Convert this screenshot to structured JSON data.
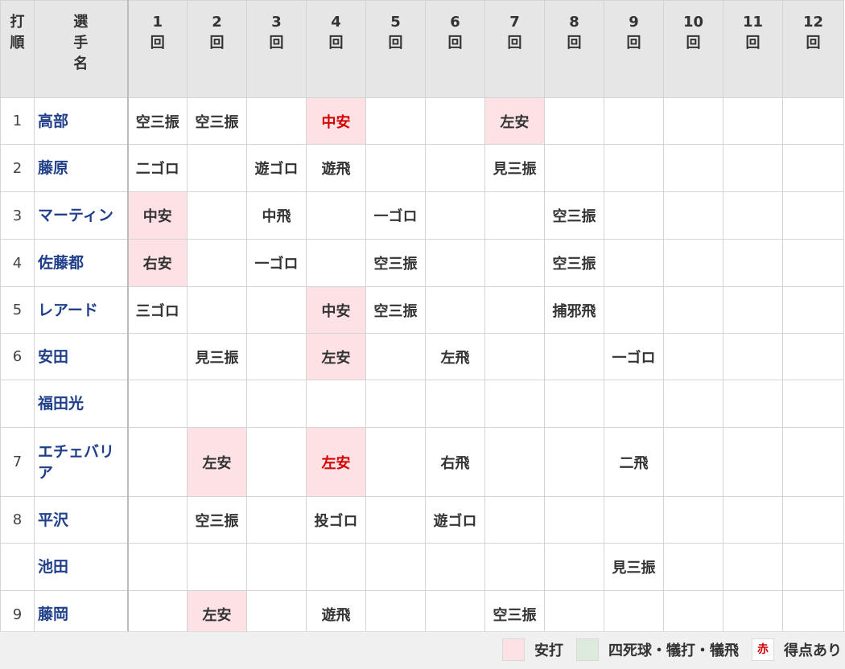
{
  "header": {
    "order_label": [
      "打",
      "順"
    ],
    "name_label": [
      "選",
      "手",
      "名"
    ],
    "innings": [
      [
        "1",
        "回"
      ],
      [
        "2",
        "回"
      ],
      [
        "3",
        "回"
      ],
      [
        "4",
        "回"
      ],
      [
        "5",
        "回"
      ],
      [
        "6",
        "回"
      ],
      [
        "7",
        "回"
      ],
      [
        "8",
        "回"
      ],
      [
        "9",
        "回"
      ],
      [
        "10",
        "回"
      ],
      [
        "11",
        "回"
      ],
      [
        "12",
        "回"
      ]
    ]
  },
  "rows": [
    {
      "order": "1",
      "name": "高部",
      "results": [
        {
          "text": "空三振",
          "type": ""
        },
        {
          "text": "空三振",
          "type": ""
        },
        {
          "text": "",
          "type": ""
        },
        {
          "text": "中安",
          "type": "hit",
          "scored": true
        },
        {
          "text": "",
          "type": ""
        },
        {
          "text": "",
          "type": ""
        },
        {
          "text": "左安",
          "type": "hit"
        },
        {
          "text": "",
          "type": ""
        },
        {
          "text": "",
          "type": ""
        },
        {
          "text": "",
          "type": ""
        },
        {
          "text": "",
          "type": ""
        },
        {
          "text": "",
          "type": ""
        }
      ]
    },
    {
      "order": "2",
      "name": "藤原",
      "results": [
        {
          "text": "二ゴロ",
          "type": ""
        },
        {
          "text": "",
          "type": ""
        },
        {
          "text": "遊ゴロ",
          "type": ""
        },
        {
          "text": "遊飛",
          "type": ""
        },
        {
          "text": "",
          "type": ""
        },
        {
          "text": "",
          "type": ""
        },
        {
          "text": "見三振",
          "type": ""
        },
        {
          "text": "",
          "type": ""
        },
        {
          "text": "",
          "type": ""
        },
        {
          "text": "",
          "type": ""
        },
        {
          "text": "",
          "type": ""
        },
        {
          "text": "",
          "type": ""
        }
      ]
    },
    {
      "order": "3",
      "name": "マーティン",
      "results": [
        {
          "text": "中安",
          "type": "hit"
        },
        {
          "text": "",
          "type": ""
        },
        {
          "text": "中飛",
          "type": ""
        },
        {
          "text": "",
          "type": ""
        },
        {
          "text": "一ゴロ",
          "type": ""
        },
        {
          "text": "",
          "type": ""
        },
        {
          "text": "",
          "type": ""
        },
        {
          "text": "空三振",
          "type": ""
        },
        {
          "text": "",
          "type": ""
        },
        {
          "text": "",
          "type": ""
        },
        {
          "text": "",
          "type": ""
        },
        {
          "text": "",
          "type": ""
        }
      ]
    },
    {
      "order": "4",
      "name": "佐藤都",
      "results": [
        {
          "text": "右安",
          "type": "hit"
        },
        {
          "text": "",
          "type": ""
        },
        {
          "text": "一ゴロ",
          "type": ""
        },
        {
          "text": "",
          "type": ""
        },
        {
          "text": "空三振",
          "type": ""
        },
        {
          "text": "",
          "type": ""
        },
        {
          "text": "",
          "type": ""
        },
        {
          "text": "空三振",
          "type": ""
        },
        {
          "text": "",
          "type": ""
        },
        {
          "text": "",
          "type": ""
        },
        {
          "text": "",
          "type": ""
        },
        {
          "text": "",
          "type": ""
        }
      ]
    },
    {
      "order": "5",
      "name": "レアード",
      "results": [
        {
          "text": "三ゴロ",
          "type": ""
        },
        {
          "text": "",
          "type": ""
        },
        {
          "text": "",
          "type": ""
        },
        {
          "text": "中安",
          "type": "hit"
        },
        {
          "text": "空三振",
          "type": ""
        },
        {
          "text": "",
          "type": ""
        },
        {
          "text": "",
          "type": ""
        },
        {
          "text": "捕邪飛",
          "type": ""
        },
        {
          "text": "",
          "type": ""
        },
        {
          "text": "",
          "type": ""
        },
        {
          "text": "",
          "type": ""
        },
        {
          "text": "",
          "type": ""
        }
      ]
    },
    {
      "order": "6",
      "name": "安田",
      "results": [
        {
          "text": "",
          "type": ""
        },
        {
          "text": "見三振",
          "type": ""
        },
        {
          "text": "",
          "type": ""
        },
        {
          "text": "左安",
          "type": "hit"
        },
        {
          "text": "",
          "type": ""
        },
        {
          "text": "左飛",
          "type": ""
        },
        {
          "text": "",
          "type": ""
        },
        {
          "text": "",
          "type": ""
        },
        {
          "text": "一ゴロ",
          "type": ""
        },
        {
          "text": "",
          "type": ""
        },
        {
          "text": "",
          "type": ""
        },
        {
          "text": "",
          "type": ""
        }
      ]
    },
    {
      "order": "",
      "name": "福田光",
      "results": [
        {
          "text": "",
          "type": ""
        },
        {
          "text": "",
          "type": ""
        },
        {
          "text": "",
          "type": ""
        },
        {
          "text": "",
          "type": ""
        },
        {
          "text": "",
          "type": ""
        },
        {
          "text": "",
          "type": ""
        },
        {
          "text": "",
          "type": ""
        },
        {
          "text": "",
          "type": ""
        },
        {
          "text": "",
          "type": ""
        },
        {
          "text": "",
          "type": ""
        },
        {
          "text": "",
          "type": ""
        },
        {
          "text": "",
          "type": ""
        }
      ]
    },
    {
      "order": "7",
      "name": "エチェバリア",
      "results": [
        {
          "text": "",
          "type": ""
        },
        {
          "text": "左安",
          "type": "hit"
        },
        {
          "text": "",
          "type": ""
        },
        {
          "text": "左安",
          "type": "hit",
          "scored": true
        },
        {
          "text": "",
          "type": ""
        },
        {
          "text": "右飛",
          "type": ""
        },
        {
          "text": "",
          "type": ""
        },
        {
          "text": "",
          "type": ""
        },
        {
          "text": "二飛",
          "type": ""
        },
        {
          "text": "",
          "type": ""
        },
        {
          "text": "",
          "type": ""
        },
        {
          "text": "",
          "type": ""
        }
      ]
    },
    {
      "order": "8",
      "name": "平沢",
      "results": [
        {
          "text": "",
          "type": ""
        },
        {
          "text": "空三振",
          "type": ""
        },
        {
          "text": "",
          "type": ""
        },
        {
          "text": "投ゴロ",
          "type": ""
        },
        {
          "text": "",
          "type": ""
        },
        {
          "text": "遊ゴロ",
          "type": ""
        },
        {
          "text": "",
          "type": ""
        },
        {
          "text": "",
          "type": ""
        },
        {
          "text": "",
          "type": ""
        },
        {
          "text": "",
          "type": ""
        },
        {
          "text": "",
          "type": ""
        },
        {
          "text": "",
          "type": ""
        }
      ]
    },
    {
      "order": "",
      "name": "池田",
      "results": [
        {
          "text": "",
          "type": ""
        },
        {
          "text": "",
          "type": ""
        },
        {
          "text": "",
          "type": ""
        },
        {
          "text": "",
          "type": ""
        },
        {
          "text": "",
          "type": ""
        },
        {
          "text": "",
          "type": ""
        },
        {
          "text": "",
          "type": ""
        },
        {
          "text": "",
          "type": ""
        },
        {
          "text": "見三振",
          "type": ""
        },
        {
          "text": "",
          "type": ""
        },
        {
          "text": "",
          "type": ""
        },
        {
          "text": "",
          "type": ""
        }
      ]
    },
    {
      "order": "9",
      "name": "藤岡",
      "results": [
        {
          "text": "",
          "type": ""
        },
        {
          "text": "左安",
          "type": "hit"
        },
        {
          "text": "",
          "type": ""
        },
        {
          "text": "遊飛",
          "type": ""
        },
        {
          "text": "",
          "type": ""
        },
        {
          "text": "",
          "type": ""
        },
        {
          "text": "空三振",
          "type": ""
        },
        {
          "text": "",
          "type": ""
        },
        {
          "text": "",
          "type": ""
        },
        {
          "text": "",
          "type": ""
        },
        {
          "text": "",
          "type": ""
        },
        {
          "text": "",
          "type": ""
        }
      ]
    }
  ],
  "legend": {
    "hit_label": "安打",
    "walk_label": "四死球・犠打・犠飛",
    "scored_swatch": "赤",
    "scored_label": "得点あり"
  },
  "colors": {
    "hit_bg": "#fce1e5",
    "walk_bg": "#dcebdc",
    "scored_text": "#d40000",
    "name_text": "#1f3f8a"
  }
}
